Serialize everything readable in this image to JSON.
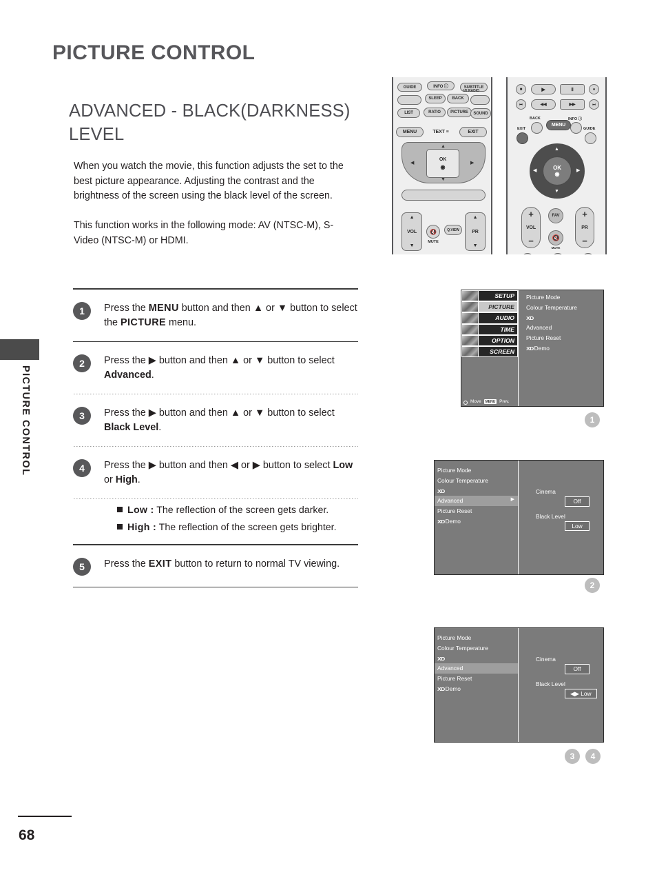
{
  "chapter": {
    "title": "PICTURE CONTROL",
    "side_tab_label": "PICTURE CONTROL"
  },
  "section": {
    "title": "ADVANCED - BLACK(DARKNESS) LEVEL"
  },
  "intro": {
    "paragraph1": "When you watch the movie, this function adjusts the set to the best picture appearance. Adjusting the contrast and the brightness of the screen using the black level of the screen.",
    "paragraph2": "This function works in the following mode: AV (NTSC-M), S-Video (NTSC-M) or HDMI."
  },
  "steps": [
    {
      "number": "1",
      "parts": [
        {
          "t": "Press the ",
          "style": "plain"
        },
        {
          "t": "MENU",
          "style": "mono"
        },
        {
          "t": " button and then ",
          "style": "plain"
        },
        {
          "t": "▲",
          "style": "plain"
        },
        {
          "t": " or ",
          "style": "plain"
        },
        {
          "t": "▼",
          "style": "plain"
        },
        {
          "t": " button to select the ",
          "style": "plain"
        },
        {
          "t": "PICTURE",
          "style": "mono"
        },
        {
          "t": " menu.",
          "style": "plain"
        }
      ]
    },
    {
      "number": "2",
      "parts": [
        {
          "t": "Press the ",
          "style": "plain"
        },
        {
          "t": "▶",
          "style": "plain"
        },
        {
          "t": " button and then ",
          "style": "plain"
        },
        {
          "t": "▲",
          "style": "plain"
        },
        {
          "t": " or ",
          "style": "plain"
        },
        {
          "t": "▼",
          "style": "plain"
        },
        {
          "t": " button to select ",
          "style": "plain"
        },
        {
          "t": "Advanced",
          "style": "bold"
        },
        {
          "t": ".",
          "style": "plain"
        }
      ]
    },
    {
      "number": "3",
      "parts": [
        {
          "t": "Press the ",
          "style": "plain"
        },
        {
          "t": "▶",
          "style": "plain"
        },
        {
          "t": " button and then ",
          "style": "plain"
        },
        {
          "t": "▲",
          "style": "plain"
        },
        {
          "t": " or ",
          "style": "plain"
        },
        {
          "t": "▼",
          "style": "plain"
        },
        {
          "t": " button to select ",
          "style": "plain"
        },
        {
          "t": "Black Level",
          "style": "bold"
        },
        {
          "t": ".",
          "style": "plain"
        }
      ]
    },
    {
      "number": "4",
      "parts": [
        {
          "t": "Press the ",
          "style": "plain"
        },
        {
          "t": "▶",
          "style": "plain"
        },
        {
          "t": " button and then ",
          "style": "plain"
        },
        {
          "t": "◀",
          "style": "plain"
        },
        {
          "t": " or ",
          "style": "plain"
        },
        {
          "t": "▶",
          "style": "plain"
        },
        {
          "t": " button to select ",
          "style": "plain"
        },
        {
          "t": "Low",
          "style": "bold"
        },
        {
          "t": " or ",
          "style": "plain"
        },
        {
          "t": "High",
          "style": "bold"
        },
        {
          "t": ".",
          "style": "plain"
        }
      ]
    },
    {
      "number": "5",
      "parts": [
        {
          "t": "Press the ",
          "style": "plain"
        },
        {
          "t": "EXIT",
          "style": "mono"
        },
        {
          "t": " button to return to normal TV viewing.",
          "style": "plain"
        }
      ]
    }
  ],
  "bullets": [
    {
      "term": "Low :",
      "desc": " The reflection of the screen gets darker."
    },
    {
      "term": "High :",
      "desc": " The reflection of the screen gets brighter."
    }
  ],
  "remote_left": {
    "row1": [
      "GUIDE",
      "INFO ⓘ",
      "SUBTITLE"
    ],
    "row2": [
      "",
      "SLEEP",
      "BACK",
      "I/II RADIO"
    ],
    "row3": [
      "LIST",
      "RATIO",
      "PICTURE",
      "SOUND"
    ],
    "row4": [
      "MENU",
      "TEXT ≡",
      "EXIT"
    ],
    "ok_label": "OK",
    "vol_label": "VOL",
    "pr_label": "PR",
    "mute_label": "MUTE",
    "qview_label": "Q.VIEW"
  },
  "remote_right": {
    "transport_row1": [
      "■",
      "▶",
      "Ⅱ",
      "●"
    ],
    "transport_row2": [
      "⏮",
      "◀◀",
      "▶▶",
      "⏭"
    ],
    "back_label": "BACK",
    "menu_label": "MENU",
    "info_label": "INFO ⓘ",
    "exit_label": "EXIT",
    "guide_label": "GUIDE",
    "ok_label": "OK",
    "vol_label": "VOL",
    "pr_label": "PR",
    "fav_label": "FAV",
    "mute_label": "MUTE",
    "plus": "+",
    "minus": "−"
  },
  "osd1": {
    "tabs": [
      {
        "label": "SETUP",
        "selected": false
      },
      {
        "label": "PICTURE",
        "selected": true
      },
      {
        "label": "AUDIO",
        "selected": false
      },
      {
        "label": "TIME",
        "selected": false
      },
      {
        "label": "OPTION",
        "selected": false
      },
      {
        "label": "SCREEN",
        "selected": false
      }
    ],
    "items": [
      {
        "label": "Picture Mode",
        "xd": false
      },
      {
        "label": "Colour Temperature",
        "xd": false
      },
      {
        "label": "XD",
        "xd": true
      },
      {
        "label": "Advanced",
        "xd": false
      },
      {
        "label": "Picture Reset",
        "xd": false
      },
      {
        "label": "XD Demo",
        "xd": true
      }
    ],
    "footer": {
      "move": "Move",
      "menu_chip": "MENU",
      "prev": "Prev."
    }
  },
  "osd2": {
    "items": [
      {
        "label": "Picture Mode",
        "highlight": false,
        "arrow": false
      },
      {
        "label": "Colour Temperature",
        "highlight": false,
        "arrow": false
      },
      {
        "label": "XD",
        "highlight": false,
        "arrow": false,
        "xd": true
      },
      {
        "label": "Advanced",
        "highlight": true,
        "arrow": true
      },
      {
        "label": "Picture Reset",
        "highlight": false,
        "arrow": false
      },
      {
        "label": "XD Demo",
        "highlight": false,
        "arrow": false,
        "xd": true
      }
    ],
    "pane": {
      "cinema_label": "Cinema",
      "cinema_value": "Off",
      "black_level_label": "Black Level",
      "black_level_value": "Low"
    }
  },
  "osd3": {
    "items": [
      {
        "label": "Picture Mode",
        "highlight": false,
        "arrow": false
      },
      {
        "label": "Colour Temperature",
        "highlight": false,
        "arrow": false
      },
      {
        "label": "XD",
        "highlight": false,
        "arrow": false,
        "xd": true
      },
      {
        "label": "Advanced",
        "highlight": true,
        "arrow": false
      },
      {
        "label": "Picture Reset",
        "highlight": false,
        "arrow": false
      },
      {
        "label": "XD Demo",
        "highlight": false,
        "arrow": false,
        "xd": true
      }
    ],
    "pane": {
      "cinema_label": "Cinema",
      "cinema_value": "Off",
      "black_level_label": "Black Level",
      "black_level_value": "◀▶ Low"
    }
  },
  "callouts": {
    "one": "1",
    "two": "2",
    "three": "3",
    "four": "4"
  },
  "footer": {
    "page_number": "68"
  },
  "colors": {
    "heading": "#56565a",
    "badge": "#58585a",
    "callout": "#bdbdbd",
    "osd_bg": "#7b7b7b",
    "osd_highlight": "#9e9e9e",
    "side_tab": "#4b4b4b"
  }
}
